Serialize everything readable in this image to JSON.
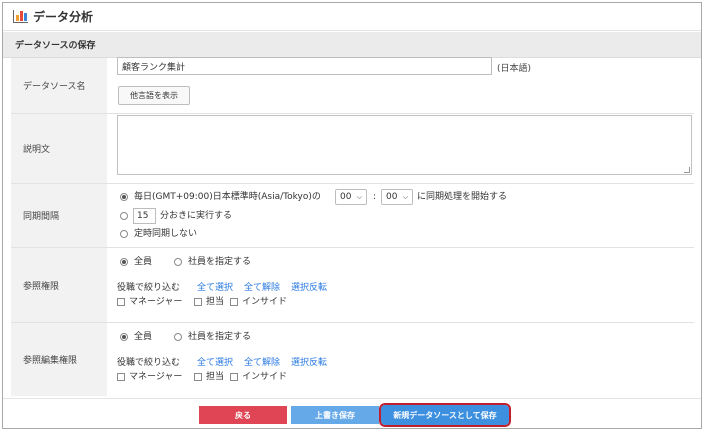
{
  "app": {
    "title": "データ分析",
    "icon": "bar-chart-icon"
  },
  "section": {
    "title": "データソースの保存"
  },
  "datasource_name": {
    "label": "データソース名",
    "value": "顧客ランク集計",
    "lang_note": "(日本語)",
    "other_lang_button": "他言語を表示"
  },
  "description": {
    "label": "説明文",
    "value": ""
  },
  "sync": {
    "label": "同期間隔",
    "option_daily_prefix": "毎日(GMT+09:00)日本標準時(Asia/Tokyo)の",
    "hour_value": "00",
    "colon": ":",
    "minute_value": "00",
    "option_daily_suffix": "に同期処理を開始する",
    "interval_value": "15",
    "option_interval_suffix": "分おきに実行する",
    "option_none": "定時同期しない",
    "selected": "daily"
  },
  "view_permission": {
    "label": "参照権限",
    "option_all": "全員",
    "option_specify": "社員を指定する",
    "filter_label": "役職で絞り込む",
    "select_all": "全て選択",
    "deselect_all": "全て解除",
    "invert": "選択反転",
    "roles": [
      "マネージャー",
      "担当",
      "インサイド"
    ]
  },
  "edit_permission": {
    "label": "参照編集権限",
    "option_all": "全員",
    "option_specify": "社員を指定する",
    "filter_label": "役職で絞り込む",
    "select_all": "全て選択",
    "deselect_all": "全て解除",
    "invert": "選択反転",
    "roles": [
      "マネージャー",
      "担当",
      "インサイド"
    ]
  },
  "footer": {
    "back": "戻る",
    "overwrite": "上書き保存",
    "save_new": "新規データソースとして保存"
  },
  "colors": {
    "back_button": "#e04556",
    "overwrite_button": "#66a9e8",
    "save_new_button": "#3d8fe0",
    "link": "#2a7ae2",
    "highlight_border": "#c0202e"
  }
}
